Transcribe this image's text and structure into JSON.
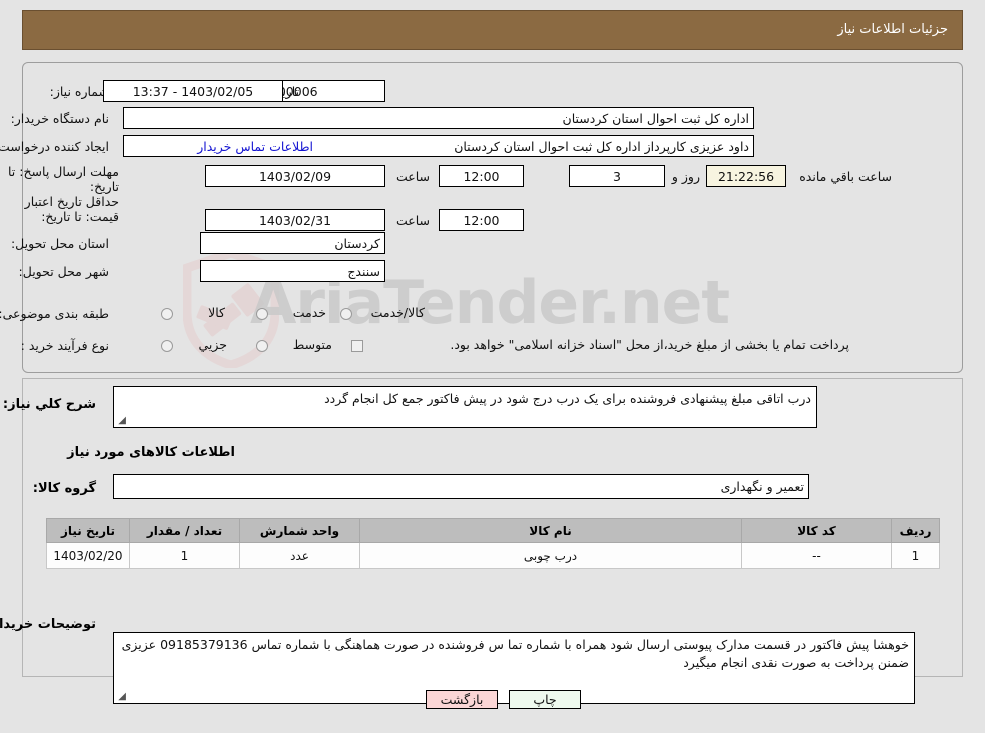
{
  "header": {
    "title": "جزئیات اطلاعات نیاز"
  },
  "watermark": {
    "text": "AriaTender.net",
    "shield_color": "#e3b6b6"
  },
  "form": {
    "need_number_label": "شماره نیاز:",
    "need_number_value": "1103003241000006",
    "public_announce_label": "تاریخ و ساعت اعلان عمومی:",
    "public_announce_value": "13:37 - 1403/02/05",
    "buyer_org_label": "نام دستگاه خریدار:",
    "buyer_org_value": "اداره کل ثبت احوال استان کردستان",
    "requester_label": "ایجاد کننده درخواست:",
    "requester_value": "داود عزیزی کارپرداز اداره کل ثبت احوال استان کردستان",
    "contact_link": "اطلاعات تماس خریدار",
    "reply_deadline_label": "مهلت ارسال پاسخ: تا تاریخ:",
    "reply_deadline_date": "1403/02/09",
    "reply_deadline_hour_label": "ساعت",
    "reply_deadline_time": "12:00",
    "countdown_days": "3",
    "countdown_days_sep": "روز و",
    "countdown_clock": "21:22:56",
    "countdown_suffix": "ساعت باقي مانده",
    "price_validity_label": "حداقل تاریخ اعتبار قیمت: تا تاریخ:",
    "price_validity_date": "1403/02/31",
    "price_validity_hour_label": "ساعت",
    "price_validity_time": "12:00",
    "delivery_province_label": "استان محل تحویل:",
    "delivery_province_value": "کردستان",
    "delivery_city_label": "شهر محل تحویل:",
    "delivery_city_value": "سنندج",
    "category_label": "طبقه بندی موضوعی:",
    "category_options": [
      "کالا",
      "خدمت",
      "کالا/خدمت"
    ],
    "process_type_label": "نوع فرآیند خرید :",
    "process_type_options": [
      "جزیي",
      "متوسط"
    ],
    "treasury_note": "پرداخت تمام یا بخشی از مبلغ خرید،از محل \"اسناد خزانه اسلامی\" خواهد بود."
  },
  "description": {
    "label": "شرح کلي نیاز:",
    "value": "درب اتاقی  مبلغ پیشنهادی فروشنده برای یک درب درج شود در پیش فاکتور جمع کل انجام گردد"
  },
  "goods_section": {
    "heading": "اطلاعات کالاهای مورد نیاز",
    "group_label": "گروه کالا:",
    "group_value": "تعمیر و نگهداری"
  },
  "items_table": {
    "columns": [
      "ردیف",
      "کد کالا",
      "نام کالا",
      "واحد شمارش",
      "تعداد / مقدار",
      "تاریخ نیاز"
    ],
    "rows": [
      {
        "row": "1",
        "code": "--",
        "name": "درب چوبی",
        "unit": "عدد",
        "qty": "1",
        "need_date": "1403/02/20"
      }
    ]
  },
  "buyer_notes": {
    "label": "توضیحات خریدار:",
    "value": "خوهشا پیش فاکتور در قسمت مدارک پیوستی ارسال شود همراه با  شماره تما س فروشنده  در صورت هماهنگی با شماره تماس 09185379136 عزیزی ضمنن پرداخت به صورت نقدی انجام میگیرد"
  },
  "footer": {
    "print_label": "چاپ",
    "back_label": "بازگشت"
  }
}
